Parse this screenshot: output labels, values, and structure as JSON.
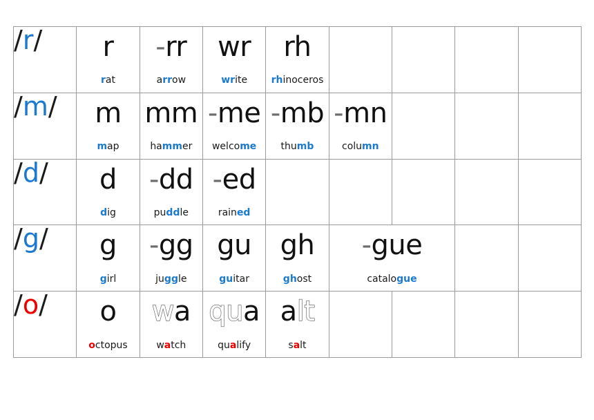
{
  "doc": {
    "title": "Phoneme / Grapheme correspondence chart",
    "columns": 9,
    "rows": 5,
    "colors": {
      "phoneme_cell_background": "#fbfaa6",
      "grid_line": "#9a9a9a",
      "highlight_blue": "#1b7acf",
      "highlight_red": "#ee0000",
      "text_black": "#111111",
      "dash_grey": "#6d6d6d"
    }
  },
  "rows": [
    {
      "phoneme": {
        "open": "/",
        "core": "r",
        "close": "/",
        "core_color": "#1b7acf"
      },
      "cells": [
        {
          "grapheme_prefix": "",
          "grapheme": "r",
          "example_pre": "",
          "example_hl": "r",
          "example_post": "at",
          "example_full": "rat",
          "hl_color": "#1b7acf"
        },
        {
          "grapheme_prefix": "-",
          "grapheme": "rr",
          "example_pre": "a",
          "example_hl": "rr",
          "example_post": "ow",
          "example_full": "arrow",
          "hl_color": "#1b7acf"
        },
        {
          "grapheme_prefix": "",
          "grapheme": "wr",
          "example_pre": "",
          "example_hl": "wr",
          "example_post": "ite",
          "example_full": "write",
          "hl_color": "#1b7acf"
        },
        {
          "grapheme_prefix": "",
          "grapheme": "rh",
          "example_pre": "",
          "example_hl": "rh",
          "example_post": "inoceros",
          "example_full": "rhinoceros",
          "hl_color": "#1b7acf"
        }
      ],
      "empty_cells": 4
    },
    {
      "phoneme": {
        "open": "/",
        "core": "m",
        "close": "/",
        "core_color": "#1b7acf"
      },
      "cells": [
        {
          "grapheme_prefix": "",
          "grapheme": "m",
          "example_pre": "",
          "example_hl": "m",
          "example_post": "ap",
          "example_full": "map",
          "hl_color": "#1b7acf"
        },
        {
          "grapheme_prefix": "",
          "grapheme": "mm",
          "example_pre": "ha",
          "example_hl": "mm",
          "example_post": "er",
          "example_full": "hammer",
          "hl_color": "#1b7acf"
        },
        {
          "grapheme_prefix": "-",
          "grapheme": "me",
          "example_pre": "welco",
          "example_hl": "me",
          "example_post": "",
          "example_full": "welcome",
          "hl_color": "#1b7acf"
        },
        {
          "grapheme_prefix": "-",
          "grapheme": "mb",
          "example_pre": "thu",
          "example_hl": "mb",
          "example_post": "",
          "example_full": "thumb",
          "hl_color": "#1b7acf"
        },
        {
          "grapheme_prefix": "-",
          "grapheme": "mn",
          "example_pre": "colu",
          "example_hl": "mn",
          "example_post": "",
          "example_full": "column",
          "hl_color": "#1b7acf"
        }
      ],
      "empty_cells": 3
    },
    {
      "phoneme": {
        "open": "/",
        "core": "d",
        "close": "/",
        "core_color": "#1b7acf"
      },
      "cells": [
        {
          "grapheme_prefix": "",
          "grapheme": "d",
          "example_pre": "",
          "example_hl": "d",
          "example_post": "ig",
          "example_full": "dig",
          "hl_color": "#1b7acf"
        },
        {
          "grapheme_prefix": "-",
          "grapheme": "dd",
          "example_pre": "pu",
          "example_hl": "dd",
          "example_post": "le",
          "example_full": "puddle",
          "hl_color": "#1b7acf"
        },
        {
          "grapheme_prefix": "-",
          "grapheme": "ed",
          "example_pre": "rain",
          "example_hl": "ed",
          "example_post": "",
          "example_full": "rained",
          "hl_color": "#1b7acf"
        }
      ],
      "empty_cells": 5
    },
    {
      "phoneme": {
        "open": "/",
        "core": "g",
        "close": "/",
        "core_color": "#1b7acf"
      },
      "cells": [
        {
          "grapheme_prefix": "",
          "grapheme": "g",
          "example_pre": "",
          "example_hl": "g",
          "example_post": "irl",
          "example_full": "girl",
          "hl_color": "#1b7acf"
        },
        {
          "grapheme_prefix": "-",
          "grapheme": "gg",
          "example_pre": "ju",
          "example_hl": "gg",
          "example_post": "le",
          "example_full": "juggle",
          "hl_color": "#1b7acf"
        },
        {
          "grapheme_prefix": "",
          "grapheme": "gu",
          "example_pre": "",
          "example_hl": "gu",
          "example_post": "itar",
          "example_full": "guitar",
          "hl_color": "#1b7acf"
        },
        {
          "grapheme_prefix": "",
          "grapheme": "gh",
          "example_pre": "",
          "example_hl": "gh",
          "example_post": "ost",
          "example_full": "ghost",
          "hl_color": "#1b7acf"
        },
        {
          "grapheme_prefix": "-",
          "grapheme": "gue",
          "example_pre": "catalo",
          "example_hl": "gue",
          "example_post": "",
          "example_full": "catalogue",
          "hl_color": "#1b7acf",
          "colspan": 2
        }
      ],
      "empty_cells": 2
    },
    {
      "phoneme": {
        "open": "/",
        "core": "o",
        "close": "/",
        "core_color": "#ee0000"
      },
      "cells": [
        {
          "grapheme_prefix": "",
          "grapheme": "o",
          "grapheme_outline_pre": "",
          "grapheme_solid": "o",
          "grapheme_outline_post": "",
          "example_pre": "",
          "example_hl": "o",
          "example_post": "ctopus",
          "example_full": "octopus",
          "hl_color": "#ee0000"
        },
        {
          "grapheme_prefix": "",
          "grapheme": "wa",
          "grapheme_outline_pre": "w",
          "grapheme_solid": "a",
          "grapheme_outline_post": "",
          "example_pre": "w",
          "example_hl": "a",
          "example_post": "tch",
          "example_full": "watch",
          "hl_color": "#ee0000"
        },
        {
          "grapheme_prefix": "",
          "grapheme": "qua",
          "grapheme_outline_pre": "qu",
          "grapheme_solid": "a",
          "grapheme_outline_post": "",
          "example_pre": "qu",
          "example_hl": "a",
          "example_post": "lify",
          "example_full": "qualify",
          "hl_color": "#ee0000"
        },
        {
          "grapheme_prefix": "",
          "grapheme": "alt",
          "grapheme_outline_pre": "",
          "grapheme_solid": "a",
          "grapheme_outline_post": "lt",
          "example_pre": "s",
          "example_hl": "a",
          "example_post": "lt",
          "example_full": "salt",
          "hl_color": "#ee0000"
        }
      ],
      "empty_cells": 4
    }
  ]
}
